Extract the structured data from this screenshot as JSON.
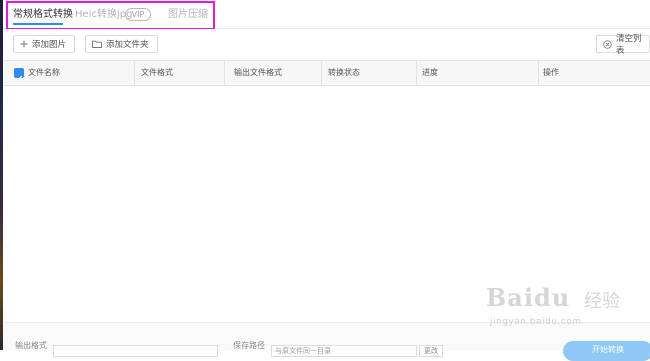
{
  "tabs": [
    {
      "label": "常规格式转换",
      "active": true
    },
    {
      "label": "Heic转换jpg",
      "badge": "VIP",
      "active": false
    },
    {
      "label": "图片压缩",
      "active": false
    }
  ],
  "toolbar": {
    "add_image": "添加图片",
    "add_folder": "添加文件夹",
    "clear_list": "清空列表"
  },
  "table": {
    "columns": [
      "文件名称",
      "文件格式",
      "输出文件格式",
      "转换状态",
      "进度",
      "操作"
    ],
    "rows": []
  },
  "footer": {
    "output_format_label": "输出格式",
    "save_path_label": "保存路径",
    "save_path_value": "与原文件同一目录",
    "change_button": "更改",
    "start_button": "开始转换"
  },
  "watermark": {
    "logo": "Baidu",
    "text": "经验",
    "url": "jingyan.baidu.com"
  },
  "colors": {
    "accent": "#2e8cf0",
    "highlight_box": "#e01be0",
    "start_button": "#8ec8f4"
  }
}
